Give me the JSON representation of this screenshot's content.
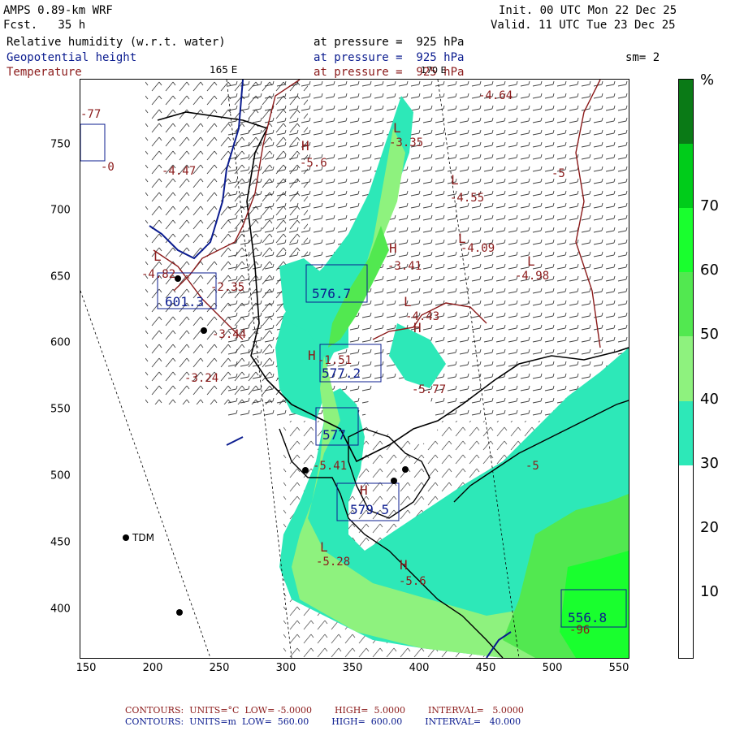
{
  "header": {
    "model": "AMPS 0.89-km WRF",
    "fcst": "Fcst.   35 h",
    "init": "Init. 00 UTC Mon 22 Dec 25",
    "valid": "Valid. 11 UTC Tue 23 Dec 25",
    "line1_field": "Relative humidity (w.r.t. water)",
    "line1_level": "at pressure =  925 hPa",
    "line2_field": "Geopotential height",
    "line2_level": "at pressure =  925 hPa",
    "line3_field": "Temperature",
    "line3_level": "at pressure =  925 hPa",
    "smoothing": "sm= 2",
    "meridian_165": "165 E",
    "meridian_170": "170 E"
  },
  "colorbar": {
    "unit": "%",
    "ticks": [
      "70",
      "60",
      "50",
      "40",
      "30",
      "20",
      "10"
    ],
    "bands": [
      {
        "from": 80,
        "to": 90,
        "color": "#0a7a16"
      },
      {
        "from": 70,
        "to": 80,
        "color": "#00cc1a"
      },
      {
        "from": 60,
        "to": 70,
        "color": "#19ff2e"
      },
      {
        "from": 50,
        "to": 60,
        "color": "#52e850"
      },
      {
        "from": 40,
        "to": 50,
        "color": "#8ef27e"
      },
      {
        "from": 30,
        "to": 40,
        "color": "#2de8b8"
      },
      {
        "from": 0,
        "to": 30,
        "color": "#ffffff"
      }
    ]
  },
  "axes": {
    "x_ticks": [
      "150",
      "200",
      "250",
      "300",
      "350",
      "400",
      "450",
      "500",
      "550"
    ],
    "y_ticks": [
      "750",
      "700",
      "650",
      "600",
      "550",
      "500",
      "450",
      "400"
    ]
  },
  "labels": {
    "temps": [
      "-4.64",
      "-4.47",
      "-5.6",
      "-3.35",
      "-4.55",
      "-5",
      "-4.09",
      "-3.41",
      "-4.98",
      "-4.82",
      "-2.35",
      "-4.43",
      "-3.44",
      "-3.24",
      "-1.51",
      "-5.77",
      "-5.41",
      "-5.28",
      "-5.6",
      "-5",
      "-0",
      "-77",
      "-96"
    ],
    "heights": [
      "576.7",
      "577.2",
      "577",
      "579.5",
      "601.3",
      "556.8"
    ],
    "hl": [
      "L",
      "H",
      "L",
      "H",
      "L",
      "L",
      "H",
      "H",
      "L",
      "H",
      "L",
      "L",
      "H"
    ],
    "station": "TDM"
  },
  "footer": {
    "red_line": "CONTOURS:  UNITS=°C  LOW= -5.0000        HIGH=  5.0000        INTERVAL=   5.0000",
    "blue_line": "CONTOURS:  UNITS=m  LOW=  560.00        HIGH=  600.00        INTERVAL=   40.000"
  },
  "colors": {
    "height_contour": "#0b1c8f",
    "temp_contour": "#8b1a1a",
    "coast": "#000000"
  }
}
